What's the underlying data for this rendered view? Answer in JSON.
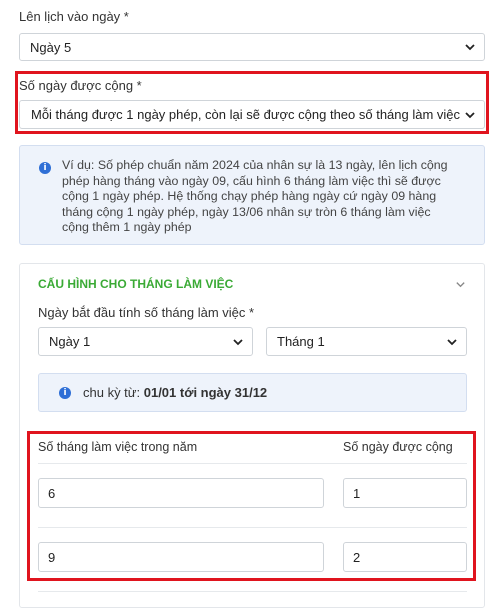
{
  "schedule": {
    "label": "Lên lịch vào ngày *",
    "value": "Ngày 5"
  },
  "added_days": {
    "label": "Số ngày được cộng *",
    "value": "Mỗi tháng được 1 ngày phép, còn lại sẽ được cộng theo số tháng làm việc"
  },
  "example_note": {
    "text": "Ví dụ: Số phép chuẩn năm 2024 của nhân sự là 13 ngày, lên lịch cộng phép hàng tháng vào ngày 09, cấu hình 6 tháng làm việc thì sẽ được cộng 1 ngày phép. Hệ thống chạy phép hàng ngày cứ ngày 09 hàng tháng cộng 1 ngày phép, ngày 13/06 nhân sự tròn 6 tháng làm việc cộng thêm 1 ngày phép"
  },
  "config": {
    "title": "CẤU HÌNH CHO THÁNG LÀM VIỆC",
    "start_label": "Ngày bắt đầu tính số tháng làm việc *",
    "start_day": "Ngày 1",
    "start_month": "Tháng 1",
    "cycle_prefix": "chu kỳ từ: ",
    "cycle_value": "01/01 tới ngày 31/12"
  },
  "table": {
    "col_months": "Số tháng làm việc trong năm",
    "col_days": "Số ngày được cộng",
    "rows": [
      {
        "months": "6",
        "days": "1"
      },
      {
        "months": "9",
        "days": "2"
      }
    ]
  },
  "colors": {
    "accent_green": "#3aaa35",
    "highlight_red": "#e0141e",
    "info_blue": "#2f6fd6",
    "info_bg": "#eef3fb"
  }
}
